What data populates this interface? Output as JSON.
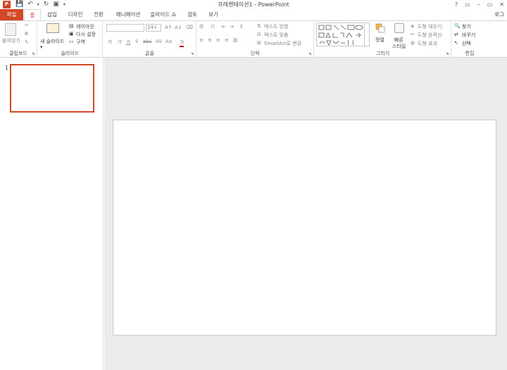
{
  "titlebar": {
    "app_logo": "P",
    "title": "프레젠테이션1 - PowerPoint",
    "controls": [
      "?",
      "▭",
      "–",
      "▭",
      "✕"
    ]
  },
  "tabs": {
    "file": "파일",
    "home": "홈",
    "insert": "삽입",
    "design": "디자인",
    "transitions": "전환",
    "animations": "애니메이션",
    "slideshow": "슬라이드 쇼",
    "review": "검토",
    "view": "보기",
    "login": "로그"
  },
  "ribbon": {
    "clipboard": {
      "label": "클립보드",
      "paste": "붙여넣기"
    },
    "slides": {
      "label": "슬라이드",
      "new_slide": "새 슬라이드",
      "layout": "레이아웃",
      "reset": "다시 설정",
      "section": "구역"
    },
    "font": {
      "label": "글꼴",
      "size": "24+",
      "bold": "가",
      "italic": "가",
      "underline": "가",
      "strike": "S",
      "spacing": "abc",
      "case": "AV",
      "aa": "Aa",
      "color": "가"
    },
    "paragraph": {
      "label": "단락",
      "direction": "텍스트 방향",
      "align": "텍스트 맞춤",
      "smartart": "SmartArt로 변환"
    },
    "drawing": {
      "label": "그리기",
      "arrange": "정렬",
      "quick_styles": "빠른",
      "quick_styles2": "스타일",
      "fill": "도형 채우기",
      "outline": "도형 윤곽선",
      "effects": "도형 효과"
    },
    "editing": {
      "label": "편집",
      "find": "찾기",
      "replace": "바꾸기",
      "select": "선택"
    }
  },
  "slides_pane": {
    "slide_number": "1"
  },
  "colors": {
    "accent": "#d24726",
    "border": "#d5d5d5",
    "canvas": "#ececec"
  }
}
